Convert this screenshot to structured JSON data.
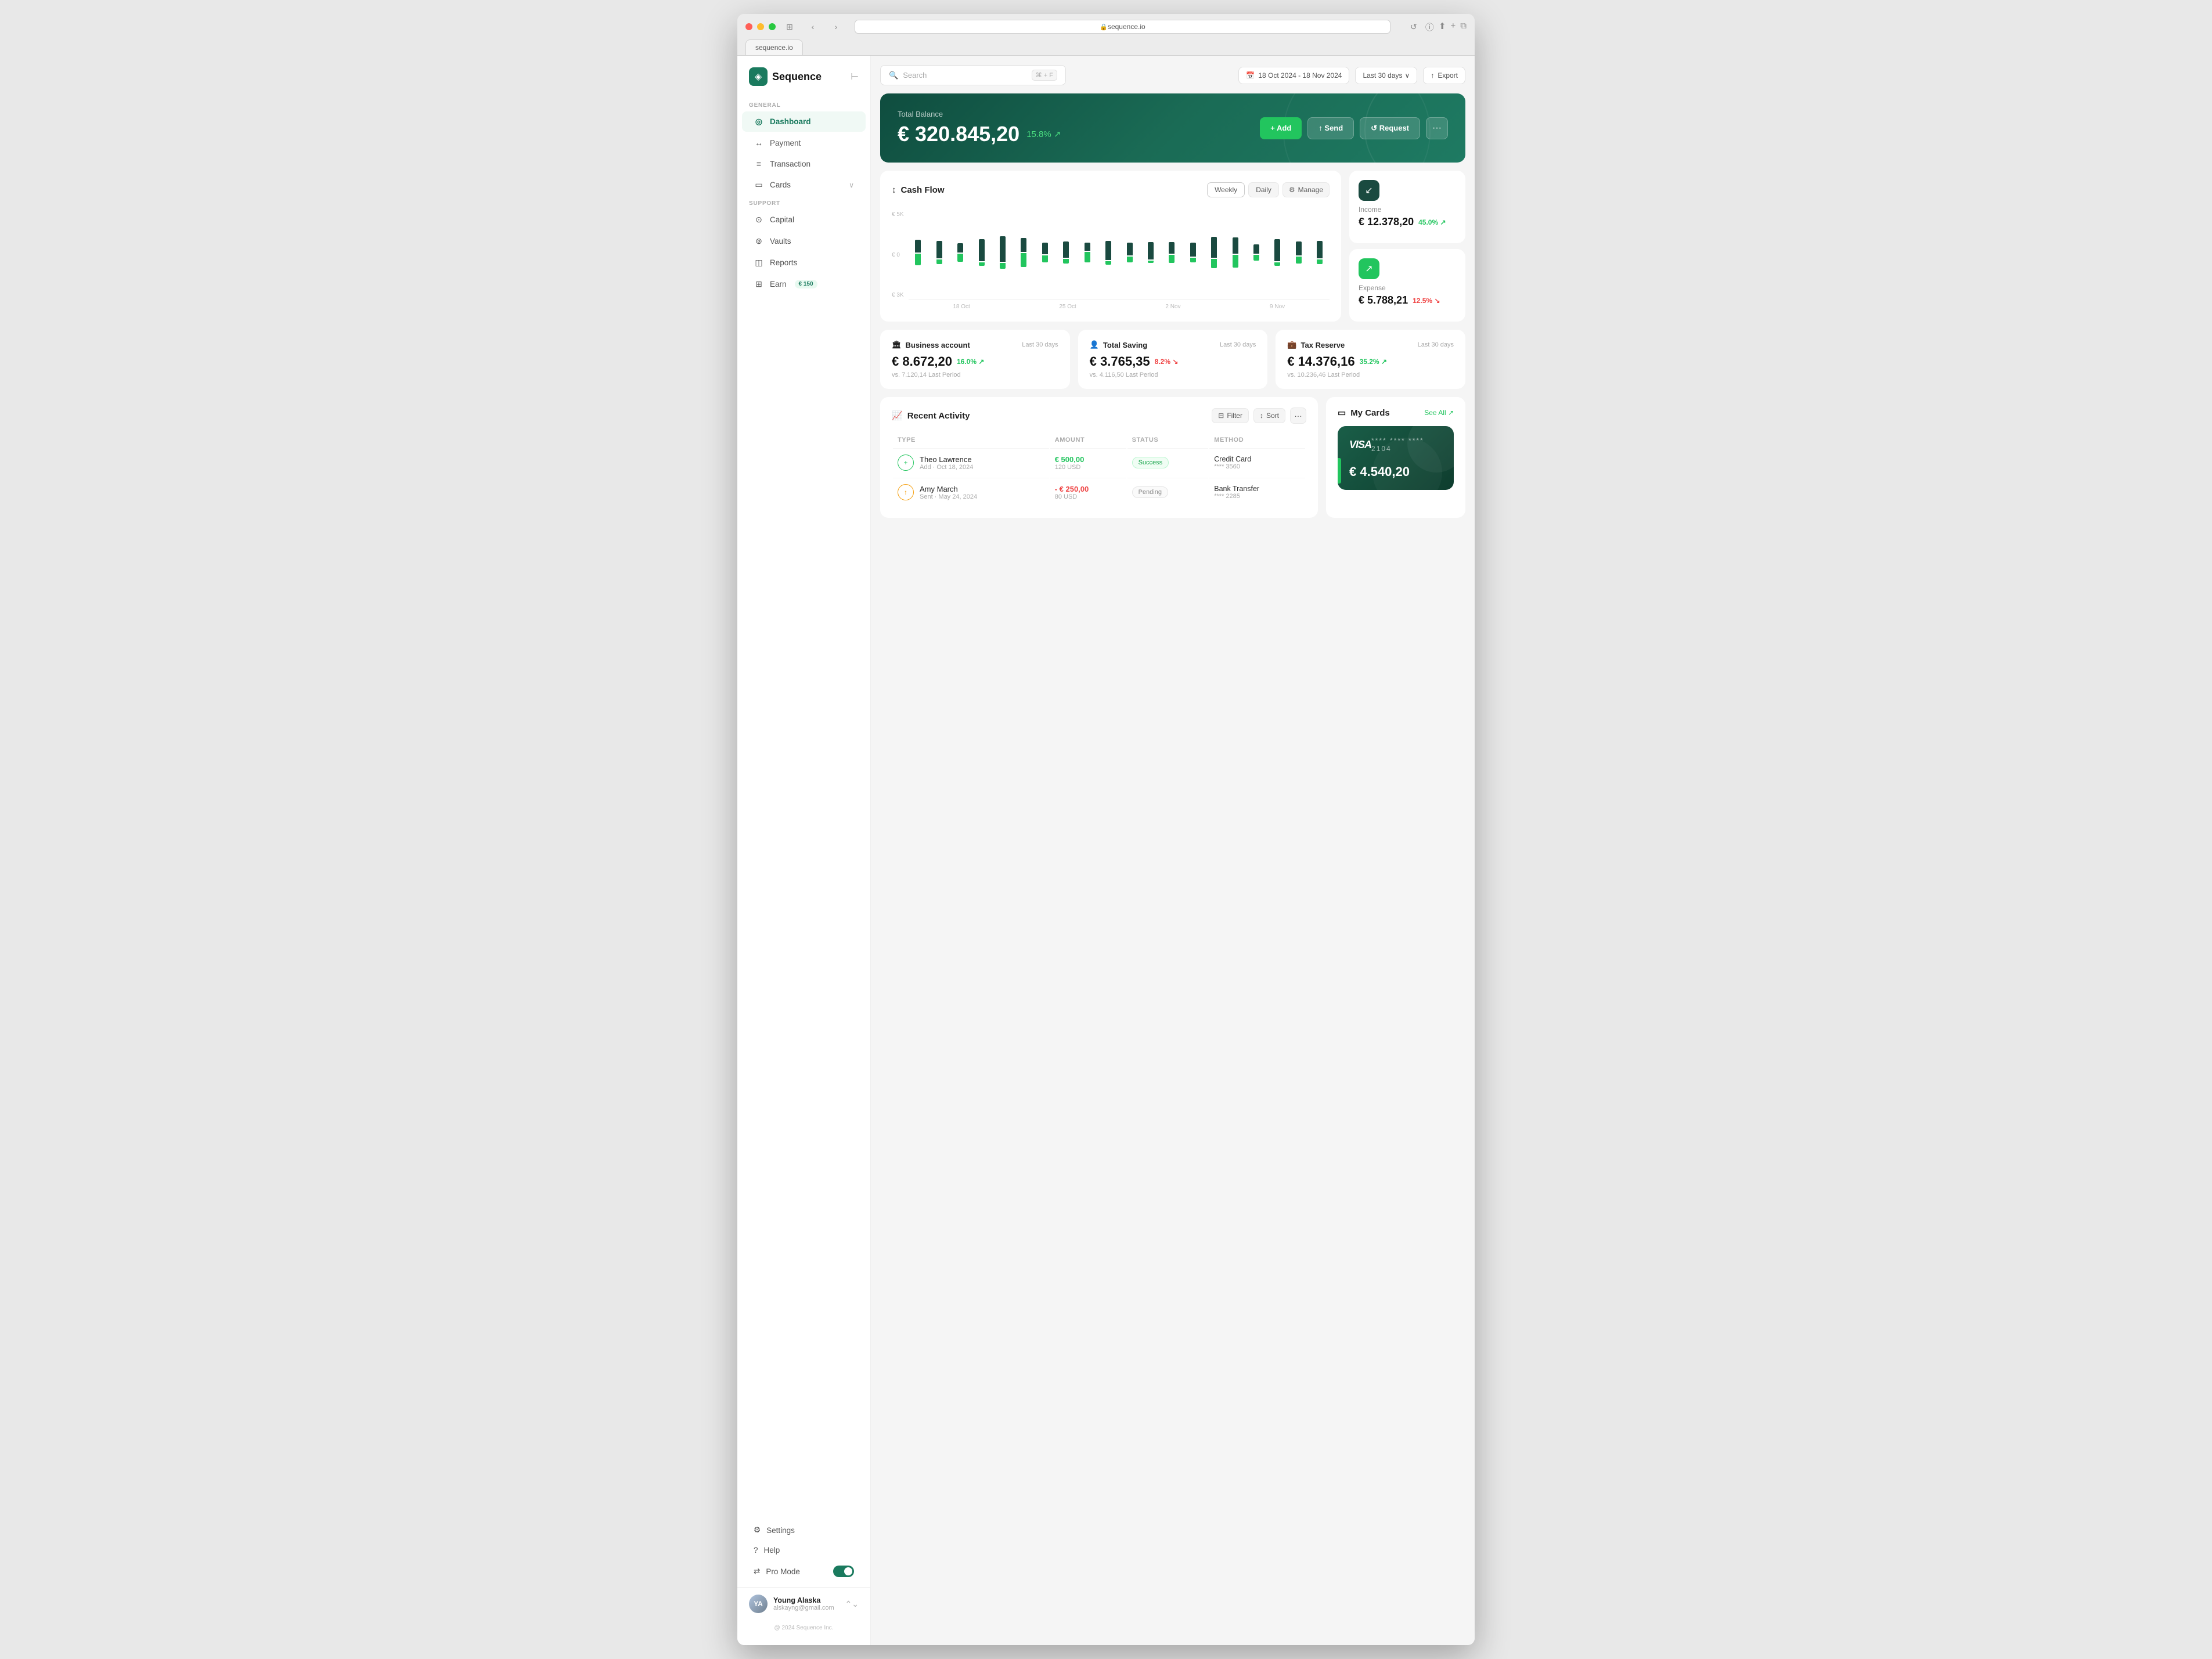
{
  "browser": {
    "url": "sequence.io",
    "tab_label": "sequence.io"
  },
  "app": {
    "logo_text": "Sequence",
    "logo_icon": "◈"
  },
  "topbar": {
    "search_placeholder": "Search",
    "search_shortcut": "⌘ + F",
    "date_range": "18 Oct 2024 - 18 Nov 2024",
    "period_label": "Last 30 days",
    "export_label": "Export"
  },
  "sidebar": {
    "general_label": "GENERAL",
    "support_label": "SUPPORT",
    "nav_items": [
      {
        "id": "dashboard",
        "label": "Dashboard",
        "icon": "◎",
        "active": true
      },
      {
        "id": "payment",
        "label": "Payment",
        "icon": "↔"
      },
      {
        "id": "transaction",
        "label": "Transaction",
        "icon": "≡"
      },
      {
        "id": "cards",
        "label": "Cards",
        "icon": "▭",
        "has_chevron": true
      }
    ],
    "support_items": [
      {
        "id": "capital",
        "label": "Capital",
        "icon": "⊙"
      },
      {
        "id": "vaults",
        "label": "Vaults",
        "icon": "⊚"
      },
      {
        "id": "reports",
        "label": "Reports",
        "icon": "◫"
      },
      {
        "id": "earn",
        "label": "Earn",
        "icon": "⊞",
        "badge": "€ 150"
      }
    ],
    "bottom_items": [
      {
        "id": "settings",
        "label": "Settings",
        "icon": "⚙"
      },
      {
        "id": "help",
        "label": "Help",
        "icon": "?"
      }
    ],
    "pro_mode_label": "Pro Mode",
    "user_name": "Young Alaska",
    "user_email": "alskayng@gmail.com",
    "user_initials": "YA",
    "copyright": "@ 2024 Sequence Inc."
  },
  "balance": {
    "label": "Total Balance",
    "amount": "€ 320.845,20",
    "change": "15.8%",
    "change_arrow": "↗",
    "btn_add": "+ Add",
    "btn_send": "↑ Send",
    "btn_request": "↺ Request",
    "btn_more": "···"
  },
  "cashflow": {
    "title": "Cash Flow",
    "btn_weekly": "Weekly",
    "btn_daily": "Daily",
    "btn_manage": "Manage",
    "y_max": "€ 5K",
    "y_zero": "€ 0",
    "y_min": "€ 3K",
    "x_labels": [
      "18 Oct",
      "25 Oct",
      "2 Nov",
      "9 Nov"
    ],
    "bars": [
      {
        "pos": 40,
        "neg": 50
      },
      {
        "pos": 55,
        "neg": 20
      },
      {
        "pos": 30,
        "neg": 35
      },
      {
        "pos": 70,
        "neg": 15
      },
      {
        "pos": 80,
        "neg": 25
      },
      {
        "pos": 45,
        "neg": 60
      },
      {
        "pos": 35,
        "neg": 30
      },
      {
        "pos": 50,
        "neg": 20
      },
      {
        "pos": 25,
        "neg": 45
      },
      {
        "pos": 60,
        "neg": 15
      },
      {
        "pos": 40,
        "neg": 25
      },
      {
        "pos": 55,
        "neg": 10
      },
      {
        "pos": 35,
        "neg": 35
      },
      {
        "pos": 45,
        "neg": 20
      },
      {
        "pos": 65,
        "neg": 40
      },
      {
        "pos": 50,
        "neg": 55
      },
      {
        "pos": 30,
        "neg": 25
      },
      {
        "pos": 70,
        "neg": 15
      },
      {
        "pos": 45,
        "neg": 30
      },
      {
        "pos": 55,
        "neg": 20
      }
    ]
  },
  "income": {
    "label": "Income",
    "amount": "€ 12.378,20",
    "change": "45.0%",
    "change_arrow": "↗"
  },
  "expense": {
    "label": "Expense",
    "amount": "€ 5.788,21",
    "change": "12.5%",
    "change_arrow": "↘"
  },
  "stats": [
    {
      "id": "business",
      "icon": "🏛",
      "title": "Business account",
      "period": "Last 30 days",
      "amount": "€ 8.672,20",
      "change": "16.0%",
      "change_dir": "up",
      "vs": "vs. 7.120,14 Last Period"
    },
    {
      "id": "saving",
      "icon": "👤",
      "title": "Total Saving",
      "period": "Last 30 days",
      "amount": "€ 3.765,35",
      "change": "8.2%",
      "change_dir": "down",
      "vs": "vs. 4.116,50 Last Period"
    },
    {
      "id": "tax",
      "icon": "💼",
      "title": "Tax Reserve",
      "period": "Last 30 days",
      "amount": "€ 14.376,16",
      "change": "35.2%",
      "change_dir": "up",
      "vs": "vs. 10.236,46 Last Period"
    }
  ],
  "activity": {
    "title": "Recent Activity",
    "btn_filter": "Filter",
    "btn_sort": "Sort",
    "col_type": "TYPE",
    "col_amount": "AMOUNT",
    "col_status": "STATUS",
    "col_method": "METHOD",
    "rows": [
      {
        "name": "Theo Lawrence",
        "sub": "Add · Oct 18, 2024",
        "icon_type": "add",
        "amount": "€ 500,00",
        "amount_sub": "120 USD",
        "amount_dir": "pos",
        "status": "Success",
        "status_type": "success",
        "method": "Credit Card",
        "method_sub": "**** 3560"
      },
      {
        "name": "Amy March",
        "sub": "Sent · May 24, 2024",
        "icon_type": "send",
        "amount": "- € 250,00",
        "amount_sub": "80 USD",
        "amount_dir": "neg",
        "status": "Pending",
        "status_type": "pending",
        "method": "Bank Transfer",
        "method_sub": "**** 2285"
      }
    ]
  },
  "my_cards": {
    "title": "My Cards",
    "see_all": "See All ↗",
    "card": {
      "brand": "VISA",
      "number": "**** **** **** 2104",
      "balance": "€ 4.540,20"
    }
  }
}
